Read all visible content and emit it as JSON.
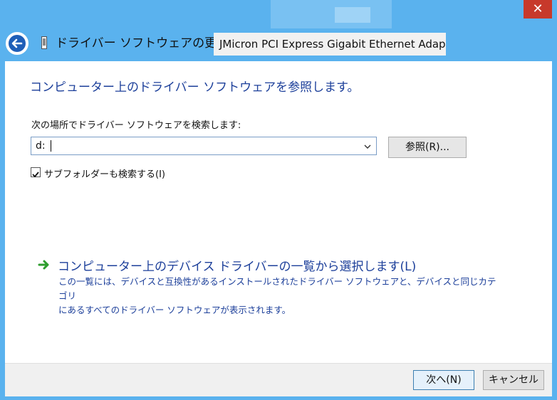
{
  "window": {
    "close_glyph": "✕",
    "title": "ドライバー ソフトウェアの更新 -",
    "device_name": "JMicron PCI Express Gigabit Ethernet Adapter"
  },
  "main": {
    "heading": "コンピューター上のドライバー ソフトウェアを参照します。",
    "search_label": "次の場所でドライバー ソフトウェアを検索します:",
    "path_value": "d:",
    "browse_label": "参照(R)...",
    "include_subfolders_checked": true,
    "include_subfolders_label": "サブフォルダーも検索する(I)",
    "pick_link_title": "コンピューター上のデバイス ドライバーの一覧から選択します(L)",
    "pick_link_desc_line1": "この一覧には、デバイスと互換性があるインストールされたドライバー ソフトウェアと、デバイスと同じカテゴリ",
    "pick_link_desc_line2": "にあるすべてのドライバー ソフトウェアが表示されます。"
  },
  "footer": {
    "next_label": "次へ(N)",
    "cancel_label": "キャンセル"
  },
  "colors": {
    "frame": "#5ab2ee",
    "link_blue": "#1c3f9a",
    "close_red": "#c7392b",
    "arrow_green": "#2e9e2e"
  },
  "icons": {
    "back": "back-arrow-icon",
    "device": "network-adapter-icon",
    "chevron": "chevron-down-icon",
    "link_arrow": "green-arrow-icon",
    "check": "checkmark-icon"
  }
}
